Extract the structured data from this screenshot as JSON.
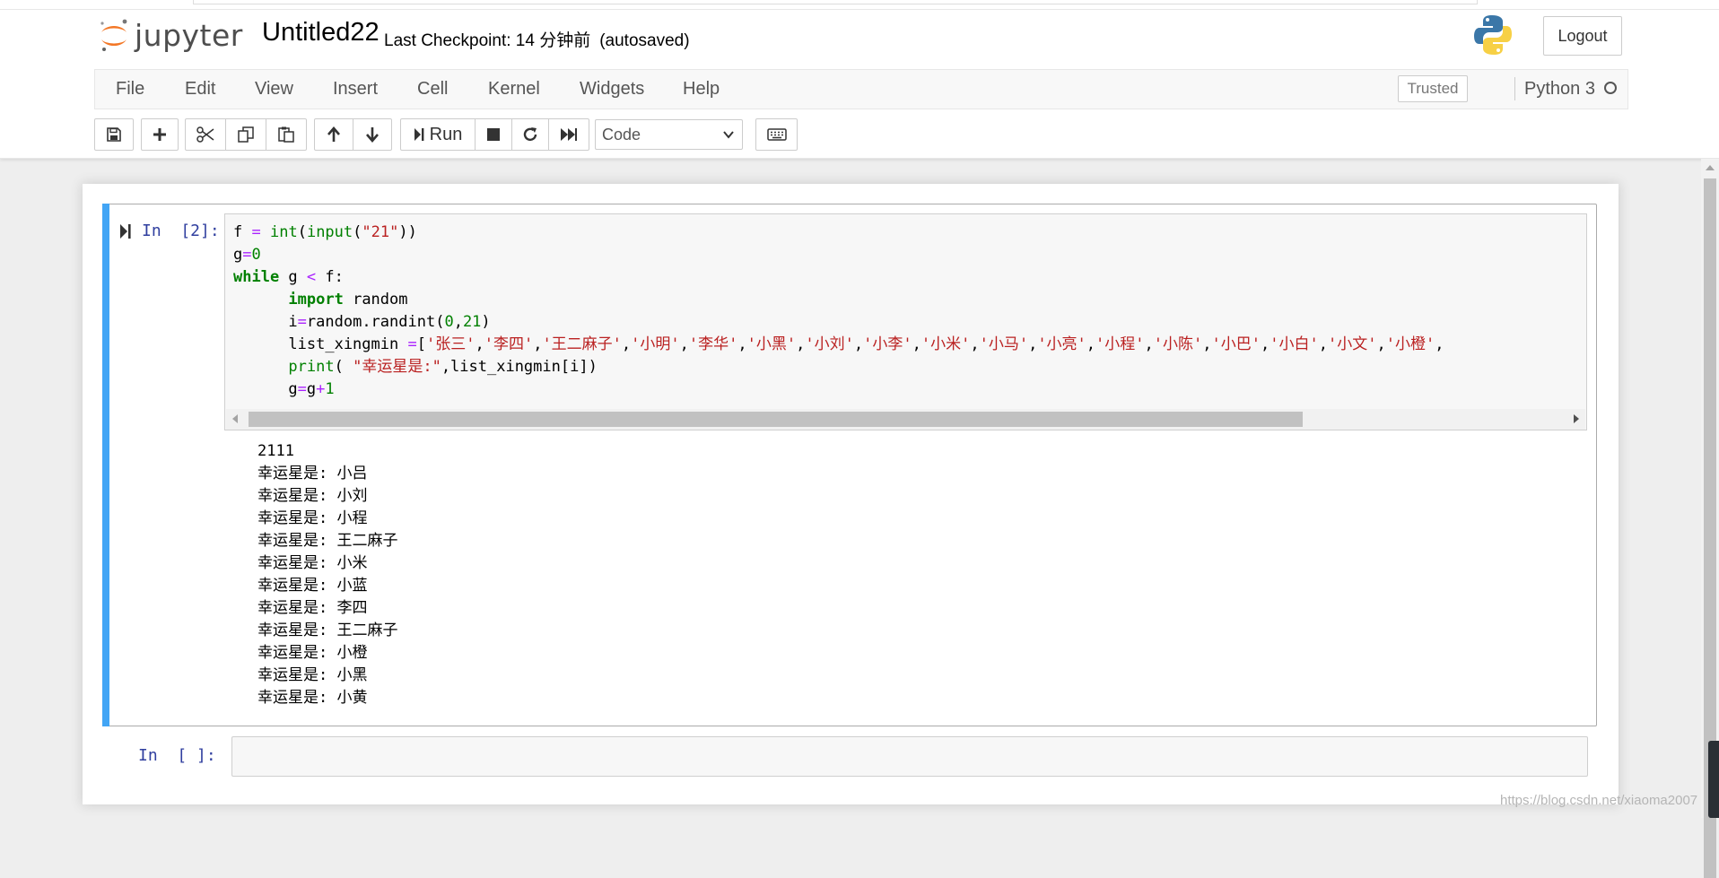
{
  "header": {
    "logo_text": "jupyter",
    "notebook_title": "Untitled22",
    "checkpoint_text": "Last Checkpoint: 14 分钟前",
    "autosave_text": "(autosaved)",
    "logout_label": "Logout"
  },
  "menubar": {
    "items": [
      "File",
      "Edit",
      "View",
      "Insert",
      "Cell",
      "Kernel",
      "Widgets",
      "Help"
    ],
    "trusted_label": "Trusted",
    "kernel_name": "Python 3"
  },
  "toolbar": {
    "run_label": "Run",
    "cell_type": "Code",
    "buttons": [
      "save-icon",
      "plus-icon",
      "cut-icon",
      "copy-icon",
      "paste-icon",
      "arrow-up-icon",
      "arrow-down-icon",
      "run-icon",
      "stop-icon",
      "restart-icon",
      "fast-forward-icon",
      "keyboard-icon"
    ]
  },
  "cells": [
    {
      "prompt": "In  [2]:",
      "code": [
        "f = int(input(\"21\"))",
        "g=0",
        "while g < f:",
        "      import random",
        "      i=random.randint(0,21)",
        "      list_xingmin =['张三','李四','王二麻子','小明','李华','小黑','小刘','小李','小米','小马','小亮','小程','小陈','小巴','小白','小文','小橙',",
        "      print( \"幸运星是:\",list_xingmin[i])",
        "      g=g+1"
      ],
      "output": [
        "2111",
        "幸运星是: 小吕",
        "幸运星是: 小刘",
        "幸运星是: 小程",
        "幸运星是: 王二麻子",
        "幸运星是: 小米",
        "幸运星是: 小蓝",
        "幸运星是: 李四",
        "幸运星是: 王二麻子",
        "幸运星是: 小橙",
        "幸运星是: 小黑",
        "幸运星是: 小黄"
      ]
    },
    {
      "prompt": "In  [ ]:",
      "code": []
    }
  ],
  "watermark": "https://blog.csdn.net/xiaoma2007",
  "colors": {
    "selected_cell_bar": "#42a5f5",
    "prompt": "#303f9f",
    "keyword": "#008000",
    "string": "#ba2121",
    "operator": "#aa22ff"
  }
}
